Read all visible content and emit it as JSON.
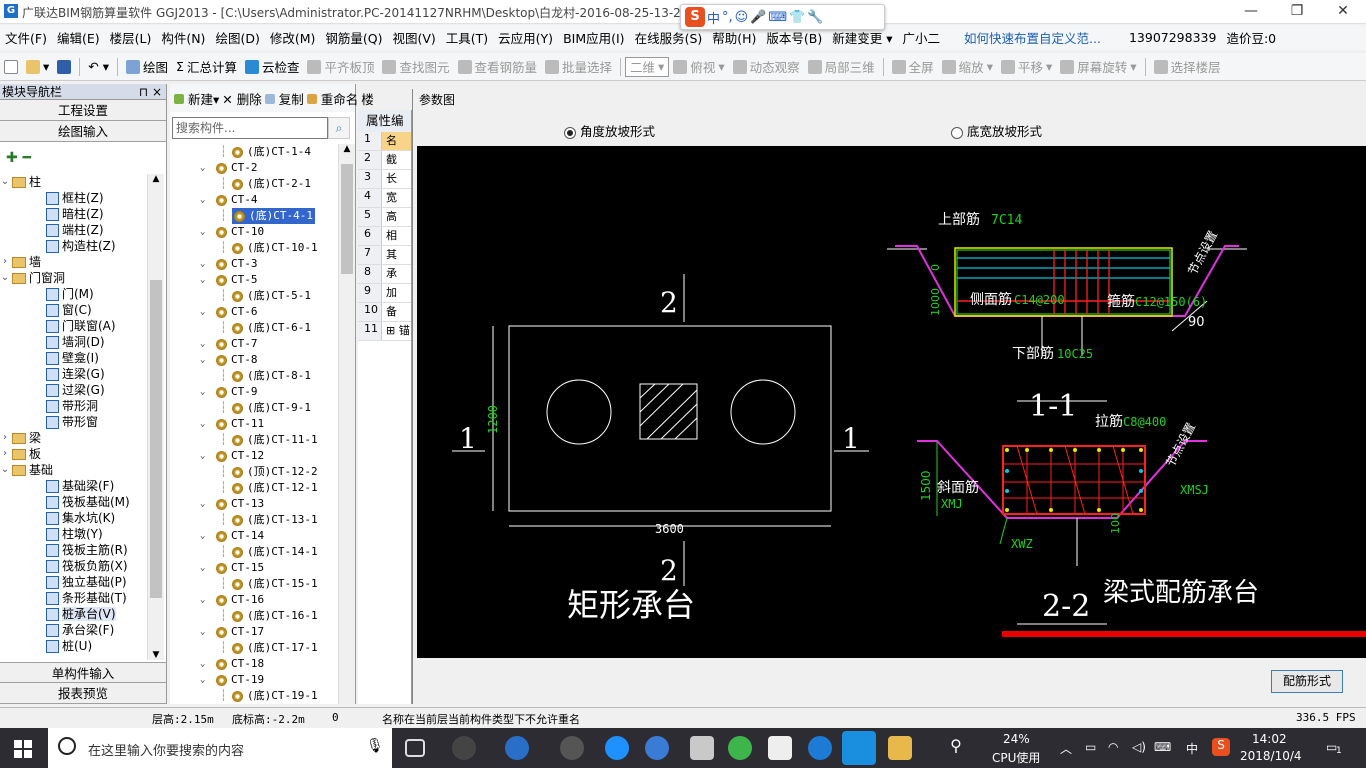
{
  "window": {
    "title": "广联达BIM钢筋算量软件 GGJ2013 - [C:\\Users\\Administrator.PC-20141127NRHM\\Desktop\\白龙村-2016-08-25-13-27",
    "app_icon": "G",
    "minimize": "—",
    "restore": "❐",
    "close": "✕"
  },
  "ime": {
    "logo": "S",
    "lang": "中",
    "items": [
      "°,",
      "☺",
      "🎤",
      "⌨",
      "👕",
      "🔧"
    ]
  },
  "menu": {
    "items": [
      "文件(F)",
      "编辑(E)",
      "楼层(L)",
      "构件(N)",
      "绘图(D)",
      "修改(M)",
      "钢筋量(Q)",
      "视图(V)",
      "工具(T)",
      "云应用(Y)",
      "BIM应用(I)",
      "在线服务(S)",
      "帮助(H)",
      "版本号(B)"
    ],
    "new_change": "新建变更",
    "assistant": "广小二",
    "help_link": "如何快速布置自定义范...",
    "phone": "13907298339",
    "price_label": "造价豆:0"
  },
  "toolbar": {
    "draw": "绘图",
    "sum": "汇总计算",
    "cloud_check": "云检查",
    "align_top": "平齐板顶",
    "find_elem": "查找图元",
    "view_rebar": "查看钢筋量",
    "batch_select": "批量选择",
    "view_mode": "二维",
    "top_view": "俯视",
    "dynamic": "动态观察",
    "local_3d": "局部三维",
    "fullscreen": "全屏",
    "zoom": "缩放",
    "pan": "平移",
    "rotate": "屏幕旋转",
    "select_floor": "选择楼层"
  },
  "nav": {
    "title": "模块导航栏",
    "pin": "⊓ ×",
    "btn_project": "工程设置",
    "btn_draw": "绘图输入",
    "btn_single": "单构件输入",
    "btn_report": "报表预览",
    "tree": [
      {
        "level": 0,
        "tog": "⌄",
        "type": "folder",
        "label": "柱"
      },
      {
        "level": 1,
        "type": "item",
        "label": "框柱(Z)"
      },
      {
        "level": 1,
        "type": "item",
        "label": "暗柱(Z)"
      },
      {
        "level": 1,
        "type": "item",
        "label": "端柱(Z)"
      },
      {
        "level": 1,
        "type": "item",
        "label": "构造柱(Z)"
      },
      {
        "level": 0,
        "tog": "›",
        "type": "folder",
        "label": "墙"
      },
      {
        "level": 0,
        "tog": "⌄",
        "type": "folder",
        "label": "门窗洞"
      },
      {
        "level": 1,
        "type": "item",
        "label": "门(M)"
      },
      {
        "level": 1,
        "type": "item",
        "label": "窗(C)"
      },
      {
        "level": 1,
        "type": "item",
        "label": "门联窗(A)"
      },
      {
        "level": 1,
        "type": "item",
        "label": "墙洞(D)"
      },
      {
        "level": 1,
        "type": "item",
        "label": "壁龛(I)"
      },
      {
        "level": 1,
        "type": "item",
        "label": "连梁(G)"
      },
      {
        "level": 1,
        "type": "item",
        "label": "过梁(G)"
      },
      {
        "level": 1,
        "type": "item",
        "label": "带形洞"
      },
      {
        "level": 1,
        "type": "item",
        "label": "带形窗"
      },
      {
        "level": 0,
        "tog": "›",
        "type": "folder",
        "label": "梁"
      },
      {
        "level": 0,
        "tog": "›",
        "type": "folder",
        "label": "板"
      },
      {
        "level": 0,
        "tog": "⌄",
        "type": "folder",
        "label": "基础"
      },
      {
        "level": 1,
        "type": "item",
        "label": "基础梁(F)"
      },
      {
        "level": 1,
        "type": "item",
        "label": "筏板基础(M)"
      },
      {
        "level": 1,
        "type": "item",
        "label": "集水坑(K)"
      },
      {
        "level": 1,
        "type": "item",
        "label": "柱墩(Y)"
      },
      {
        "level": 1,
        "type": "item",
        "label": "筏板主筋(R)"
      },
      {
        "level": 1,
        "type": "item",
        "label": "筏板负筋(X)"
      },
      {
        "level": 1,
        "type": "item",
        "label": "独立基础(P)"
      },
      {
        "level": 1,
        "type": "item",
        "label": "条形基础(T)"
      },
      {
        "level": 1,
        "type": "item",
        "label": "桩承台(V)",
        "selected": true
      },
      {
        "level": 1,
        "type": "item",
        "label": "承台梁(F)"
      },
      {
        "level": 1,
        "type": "item",
        "label": "桩(U)"
      }
    ]
  },
  "list": {
    "new": "新建",
    "delete": "删除",
    "copy": "复制",
    "rename": "重命名",
    "more": "楼",
    "search_placeholder": "搜索构件...",
    "rows": [
      {
        "level": 2,
        "label": "(底)CT-1-4"
      },
      {
        "level": 1,
        "tog": "⌄",
        "label": "CT-2"
      },
      {
        "level": 2,
        "label": "(底)CT-2-1"
      },
      {
        "level": 1,
        "tog": "⌄",
        "label": "CT-4"
      },
      {
        "level": 2,
        "label": "(底)CT-4-1",
        "selected": true
      },
      {
        "level": 1,
        "tog": "⌄",
        "label": "CT-10"
      },
      {
        "level": 2,
        "label": "(底)CT-10-1"
      },
      {
        "level": 1,
        "tog": "⌄",
        "label": "CT-3"
      },
      {
        "level": 1,
        "tog": "⌄",
        "label": "CT-5"
      },
      {
        "level": 2,
        "label": "(底)CT-5-1"
      },
      {
        "level": 1,
        "tog": "⌄",
        "label": "CT-6"
      },
      {
        "level": 2,
        "label": "(底)CT-6-1"
      },
      {
        "level": 1,
        "tog": "⌄",
        "label": "CT-7"
      },
      {
        "level": 1,
        "tog": "⌄",
        "label": "CT-8"
      },
      {
        "level": 2,
        "label": "(底)CT-8-1"
      },
      {
        "level": 1,
        "tog": "⌄",
        "label": "CT-9"
      },
      {
        "level": 2,
        "label": "(底)CT-9-1"
      },
      {
        "level": 1,
        "tog": "⌄",
        "label": "CT-11"
      },
      {
        "level": 2,
        "label": "(底)CT-11-1"
      },
      {
        "level": 1,
        "tog": "⌄",
        "label": "CT-12"
      },
      {
        "level": 2,
        "label": "(顶)CT-12-2"
      },
      {
        "level": 2,
        "label": "(底)CT-12-1"
      },
      {
        "level": 1,
        "tog": "⌄",
        "label": "CT-13"
      },
      {
        "level": 2,
        "label": "(底)CT-13-1"
      },
      {
        "level": 1,
        "tog": "⌄",
        "label": "CT-14"
      },
      {
        "level": 2,
        "label": "(底)CT-14-1"
      },
      {
        "level": 1,
        "tog": "⌄",
        "label": "CT-15"
      },
      {
        "level": 2,
        "label": "(底)CT-15-1"
      },
      {
        "level": 1,
        "tog": "⌄",
        "label": "CT-16"
      },
      {
        "level": 2,
        "label": "(底)CT-16-1"
      },
      {
        "level": 1,
        "tog": "⌄",
        "label": "CT-17"
      },
      {
        "level": 2,
        "label": "(底)CT-17-1"
      },
      {
        "level": 1,
        "tog": "⌄",
        "label": "CT-18"
      },
      {
        "level": 1,
        "tog": "⌄",
        "label": "CT-19"
      },
      {
        "level": 2,
        "label": "(底)CT-19-1"
      }
    ]
  },
  "props": {
    "title": "属性编辑",
    "rows": [
      {
        "n": "1",
        "v": "名"
      },
      {
        "n": "2",
        "v": "截"
      },
      {
        "n": "3",
        "v": "长"
      },
      {
        "n": "4",
        "v": "宽"
      },
      {
        "n": "5",
        "v": "高"
      },
      {
        "n": "6",
        "v": "相"
      },
      {
        "n": "7",
        "v": "其"
      },
      {
        "n": "8",
        "v": "承"
      },
      {
        "n": "9",
        "v": "加"
      },
      {
        "n": "10",
        "v": "备"
      },
      {
        "n": "11",
        "v": "⊞ 锚"
      }
    ]
  },
  "dialog": {
    "title": "参数图",
    "radio_angle": "角度放坡形式",
    "radio_width": "底宽放坡形式",
    "config_button": "配筋形式"
  },
  "drawing": {
    "plan": {
      "section_top": "2",
      "section_bottom": "2",
      "section_left": "1",
      "section_right": "1",
      "dim_height": "1200",
      "dim_width": "3600",
      "caption": "矩形承台"
    },
    "sec11": {
      "top_rebar_label": "上部筋",
      "top_rebar_value": "7C14",
      "side_rebar_label": "侧面筋",
      "side_rebar_value": "C14@200",
      "stirrup_label": "箍筋",
      "stirrup_value": "C12@150(6)",
      "bottom_rebar_label": "下部筋",
      "bottom_rebar_value": "10C25",
      "angle": "90",
      "zero": "0",
      "height": "1000",
      "slope_note": "节点设置",
      "caption": "1-1"
    },
    "sec22": {
      "tie_label": "拉筋",
      "tie_value": "C8@400",
      "slope_rebar_label": "斜面筋",
      "left_code": "XMJ",
      "right_code": "XMSJ",
      "bottom_code": "XWZ",
      "height": "1500",
      "cover": "100",
      "slope_note": "节点设置",
      "caption": "2-2"
    },
    "title": "梁式配筋承台"
  },
  "status": {
    "floor_height": "层高:2.15m",
    "base_elev": "底标高:-2.2m",
    "zero": "0",
    "message": "名称在当前层当前构件类型下不允许重名",
    "fps": "336.5 FPS"
  },
  "taskbar": {
    "search_placeholder": "在这里输入你要搜索的内容",
    "cpu_percent": "24%",
    "cpu_label": "CPU使用",
    "lang": "中",
    "time": "14:02",
    "date": "2018/10/4",
    "notify_count": "1"
  },
  "colors": {
    "selection": "#3366cc",
    "drawing_bg": "#000000",
    "rebar_red": "#ff2020",
    "rebar_cyan": "#00c8e0",
    "dim_green": "#20d020",
    "outline_magenta": "#e030e0",
    "accent_red_bar": "#e80000"
  }
}
